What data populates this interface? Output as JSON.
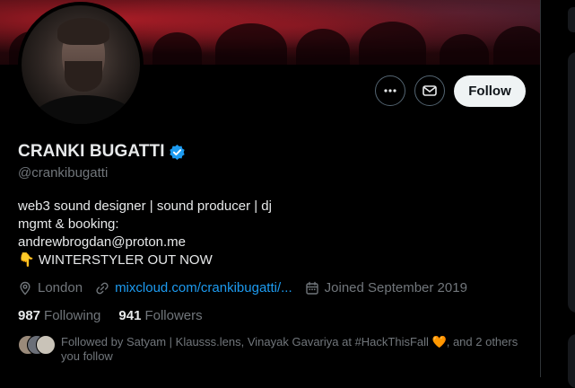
{
  "profile": {
    "name": "CRANKI BUGATTI",
    "handle": "@crankibugatti",
    "bio": [
      "web3 sound designer | sound producer | dj",
      "mgmt & booking:",
      "andrewbrogdan@proton.me",
      "👇 WINTERSTYLER OUT NOW"
    ],
    "location": "London",
    "website": "mixcloud.com/crankibugatti/...",
    "joined": "Joined September 2019"
  },
  "stats": {
    "following_count": "987",
    "following_label": "Following",
    "followers_count": "941",
    "followers_label": "Followers"
  },
  "actions": {
    "follow_label": "Follow"
  },
  "followed_by": {
    "text": "Followed by Satyam | Klausss.lens, Vinayak Gavariya at #HackThisFall 🧡, and 2 others you follow"
  },
  "colors": {
    "accent_blue": "#1d9bf0",
    "muted_text": "#71767b",
    "background": "#000000",
    "follow_button_bg": "#eff3f4"
  },
  "icons": [
    "more-icon",
    "mail-icon",
    "verified-badge-icon",
    "location-icon",
    "link-icon",
    "calendar-icon"
  ]
}
